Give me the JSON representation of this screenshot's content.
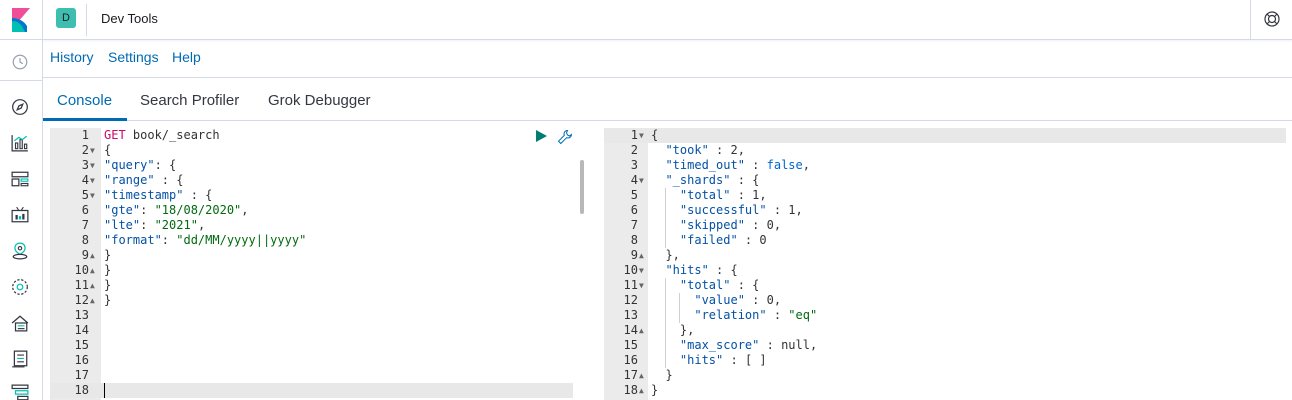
{
  "header": {
    "space_initial": "D",
    "app_title": "Dev Tools"
  },
  "topmenu": {
    "items": [
      "History",
      "Settings",
      "Help"
    ]
  },
  "tabs": {
    "items": [
      "Console",
      "Search Profiler",
      "Grok Debugger"
    ],
    "active": "Console"
  },
  "left_nav": {
    "icons": [
      "clock-icon",
      "compass-icon",
      "chart-icon",
      "dashboard-icon",
      "canvas-icon",
      "maps-icon",
      "ml-icon",
      "infra-icon",
      "logs-icon",
      "apm-icon"
    ]
  },
  "request": {
    "lines": [
      {
        "n": "1",
        "fold": "",
        "text": [
          {
            "c": "k-method",
            "t": "GET"
          },
          {
            "c": "k-url",
            "t": " book/_search"
          }
        ]
      },
      {
        "n": "2",
        "fold": "▼",
        "text": [
          {
            "c": "k-punc",
            "t": "{"
          }
        ]
      },
      {
        "n": "3",
        "fold": "▼",
        "text": [
          {
            "c": "k-key",
            "t": "\"query\""
          },
          {
            "c": "k-punc",
            "t": ": {"
          }
        ]
      },
      {
        "n": "4",
        "fold": "▼",
        "text": [
          {
            "c": "k-key",
            "t": "\"range\""
          },
          {
            "c": "k-punc",
            "t": " : {"
          }
        ]
      },
      {
        "n": "5",
        "fold": "▼",
        "text": [
          {
            "c": "k-key",
            "t": "\"timestamp\""
          },
          {
            "c": "k-punc",
            "t": " : {"
          }
        ]
      },
      {
        "n": "6",
        "fold": "",
        "text": [
          {
            "c": "k-key",
            "t": "\"gte\""
          },
          {
            "c": "k-punc",
            "t": ": "
          },
          {
            "c": "k-str",
            "t": "\"18/08/2020\""
          },
          {
            "c": "k-punc",
            "t": ","
          }
        ]
      },
      {
        "n": "7",
        "fold": "",
        "text": [
          {
            "c": "k-key",
            "t": "\"lte\""
          },
          {
            "c": "k-punc",
            "t": ": "
          },
          {
            "c": "k-str",
            "t": "\"2021\""
          },
          {
            "c": "k-punc",
            "t": ","
          }
        ]
      },
      {
        "n": "8",
        "fold": "",
        "text": [
          {
            "c": "k-key",
            "t": "\"format\""
          },
          {
            "c": "k-punc",
            "t": ": "
          },
          {
            "c": "k-str",
            "t": "\"dd/MM/yyyy||yyyy\""
          }
        ]
      },
      {
        "n": "9",
        "fold": "▲",
        "text": [
          {
            "c": "k-punc",
            "t": "}"
          }
        ]
      },
      {
        "n": "10",
        "fold": "▲",
        "text": [
          {
            "c": "k-punc",
            "t": "}"
          }
        ]
      },
      {
        "n": "11",
        "fold": "▲",
        "text": [
          {
            "c": "k-punc",
            "t": "}"
          }
        ]
      },
      {
        "n": "12",
        "fold": "▲",
        "text": [
          {
            "c": "k-punc",
            "t": "}"
          }
        ]
      },
      {
        "n": "13",
        "fold": "",
        "text": []
      },
      {
        "n": "14",
        "fold": "",
        "text": []
      },
      {
        "n": "15",
        "fold": "",
        "text": []
      },
      {
        "n": "16",
        "fold": "",
        "text": []
      },
      {
        "n": "17",
        "fold": "",
        "text": []
      },
      {
        "n": "18",
        "fold": "",
        "text": []
      }
    ]
  },
  "response": {
    "lines": [
      {
        "n": "1",
        "fold": "▼",
        "text": [
          {
            "c": "k-punc",
            "t": "{"
          }
        ]
      },
      {
        "n": "2",
        "fold": "",
        "text": [
          {
            "c": "k-plain",
            "t": "  "
          },
          {
            "c": "k-key",
            "t": "\"took\""
          },
          {
            "c": "k-punc",
            "t": " : "
          },
          {
            "c": "k-num",
            "t": "2"
          },
          {
            "c": "k-punc",
            "t": ","
          }
        ]
      },
      {
        "n": "3",
        "fold": "",
        "text": [
          {
            "c": "k-plain",
            "t": "  "
          },
          {
            "c": "k-key",
            "t": "\"timed_out\""
          },
          {
            "c": "k-punc",
            "t": " : "
          },
          {
            "c": "k-bool",
            "t": "false"
          },
          {
            "c": "k-punc",
            "t": ","
          }
        ]
      },
      {
        "n": "4",
        "fold": "▼",
        "text": [
          {
            "c": "k-plain",
            "t": "  "
          },
          {
            "c": "k-key",
            "t": "\"_shards\""
          },
          {
            "c": "k-punc",
            "t": " : {"
          }
        ]
      },
      {
        "n": "5",
        "fold": "",
        "text": [
          {
            "c": "k-plain",
            "t": "    "
          },
          {
            "c": "k-key",
            "t": "\"total\""
          },
          {
            "c": "k-punc",
            "t": " : "
          },
          {
            "c": "k-num",
            "t": "1"
          },
          {
            "c": "k-punc",
            "t": ","
          }
        ]
      },
      {
        "n": "6",
        "fold": "",
        "text": [
          {
            "c": "k-plain",
            "t": "    "
          },
          {
            "c": "k-key",
            "t": "\"successful\""
          },
          {
            "c": "k-punc",
            "t": " : "
          },
          {
            "c": "k-num",
            "t": "1"
          },
          {
            "c": "k-punc",
            "t": ","
          }
        ]
      },
      {
        "n": "7",
        "fold": "",
        "text": [
          {
            "c": "k-plain",
            "t": "    "
          },
          {
            "c": "k-key",
            "t": "\"skipped\""
          },
          {
            "c": "k-punc",
            "t": " : "
          },
          {
            "c": "k-num",
            "t": "0"
          },
          {
            "c": "k-punc",
            "t": ","
          }
        ]
      },
      {
        "n": "8",
        "fold": "",
        "text": [
          {
            "c": "k-plain",
            "t": "    "
          },
          {
            "c": "k-key",
            "t": "\"failed\""
          },
          {
            "c": "k-punc",
            "t": " : "
          },
          {
            "c": "k-num",
            "t": "0"
          }
        ]
      },
      {
        "n": "9",
        "fold": "▲",
        "text": [
          {
            "c": "k-plain",
            "t": "  "
          },
          {
            "c": "k-punc",
            "t": "},"
          }
        ]
      },
      {
        "n": "10",
        "fold": "▼",
        "text": [
          {
            "c": "k-plain",
            "t": "  "
          },
          {
            "c": "k-key",
            "t": "\"hits\""
          },
          {
            "c": "k-punc",
            "t": " : {"
          }
        ]
      },
      {
        "n": "11",
        "fold": "▼",
        "text": [
          {
            "c": "k-plain",
            "t": "    "
          },
          {
            "c": "k-key",
            "t": "\"total\""
          },
          {
            "c": "k-punc",
            "t": " : {"
          }
        ]
      },
      {
        "n": "12",
        "fold": "",
        "text": [
          {
            "c": "k-plain",
            "t": "      "
          },
          {
            "c": "k-key",
            "t": "\"value\""
          },
          {
            "c": "k-punc",
            "t": " : "
          },
          {
            "c": "k-num",
            "t": "0"
          },
          {
            "c": "k-punc",
            "t": ","
          }
        ]
      },
      {
        "n": "13",
        "fold": "",
        "text": [
          {
            "c": "k-plain",
            "t": "      "
          },
          {
            "c": "k-key",
            "t": "\"relation\""
          },
          {
            "c": "k-punc",
            "t": " : "
          },
          {
            "c": "k-str",
            "t": "\"eq\""
          }
        ]
      },
      {
        "n": "14",
        "fold": "▲",
        "text": [
          {
            "c": "k-plain",
            "t": "    "
          },
          {
            "c": "k-punc",
            "t": "},"
          }
        ]
      },
      {
        "n": "15",
        "fold": "",
        "text": [
          {
            "c": "k-plain",
            "t": "    "
          },
          {
            "c": "k-key",
            "t": "\"max_score\""
          },
          {
            "c": "k-punc",
            "t": " : "
          },
          {
            "c": "k-plain",
            "t": "null"
          },
          {
            "c": "k-punc",
            "t": ","
          }
        ]
      },
      {
        "n": "16",
        "fold": "",
        "text": [
          {
            "c": "k-plain",
            "t": "    "
          },
          {
            "c": "k-key",
            "t": "\"hits\""
          },
          {
            "c": "k-punc",
            "t": " : [ ]"
          }
        ]
      },
      {
        "n": "17",
        "fold": "▲",
        "text": [
          {
            "c": "k-plain",
            "t": "  "
          },
          {
            "c": "k-punc",
            "t": "}"
          }
        ]
      },
      {
        "n": "18",
        "fold": "▲",
        "text": [
          {
            "c": "k-punc",
            "t": "}"
          }
        ]
      }
    ]
  },
  "colors": {
    "accent": "#006bb4",
    "badge": "#3ebeb0",
    "run": "#017d73"
  }
}
